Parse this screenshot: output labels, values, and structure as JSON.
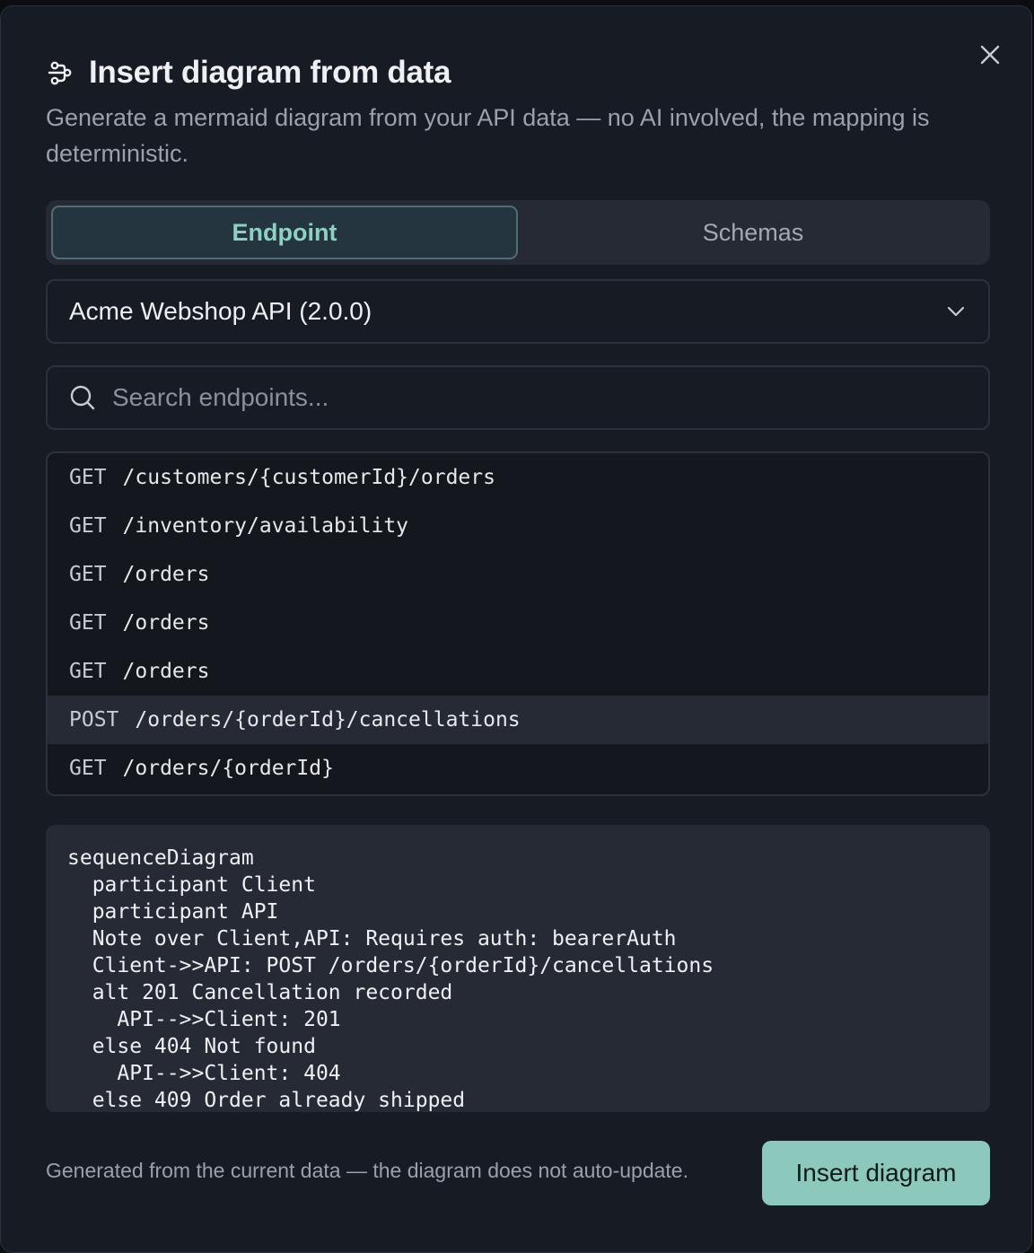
{
  "dialog": {
    "title": "Insert diagram from data",
    "subtitle": "Generate a mermaid diagram from your API data — no AI involved, the mapping is deterministic.",
    "title_icon": "diagram-flow-icon",
    "close_icon": "close-icon"
  },
  "tabs": [
    {
      "label": "Endpoint",
      "active": true
    },
    {
      "label": "Schemas",
      "active": false
    }
  ],
  "api_select": {
    "value": "Acme Webshop API (2.0.0)",
    "icon": "chevron-down-icon"
  },
  "search": {
    "placeholder": "Search endpoints...",
    "value": "",
    "icon": "search-icon"
  },
  "endpoints": [
    {
      "method": "GET",
      "path": "/customers/{customerId}/orders",
      "selected": false
    },
    {
      "method": "GET",
      "path": "/inventory/availability",
      "selected": false
    },
    {
      "method": "GET",
      "path": "/orders",
      "selected": false
    },
    {
      "method": "GET",
      "path": "/orders",
      "selected": false
    },
    {
      "method": "GET",
      "path": "/orders",
      "selected": false
    },
    {
      "method": "POST",
      "path": "/orders/{orderId}/cancellations",
      "selected": true
    },
    {
      "method": "GET",
      "path": "/orders/{orderId}",
      "selected": false
    }
  ],
  "code_lines": [
    "sequenceDiagram",
    "  participant Client",
    "  participant API",
    "  Note over Client,API: Requires auth: bearerAuth",
    "  Client->>API: POST /orders/{orderId}/cancellations",
    "  alt 201 Cancellation recorded",
    "    API-->>Client: 201",
    "  else 404 Not found",
    "    API-->>Client: 404",
    "  else 409 Order already shipped"
  ],
  "footer": {
    "note": "Generated from the current data — the diagram does not auto-update.",
    "insert_label": "Insert diagram"
  },
  "colors": {
    "accent": "#8cc9bc",
    "active_tab_text": "#8ed1c2",
    "dialog_bg": "#171b23"
  }
}
